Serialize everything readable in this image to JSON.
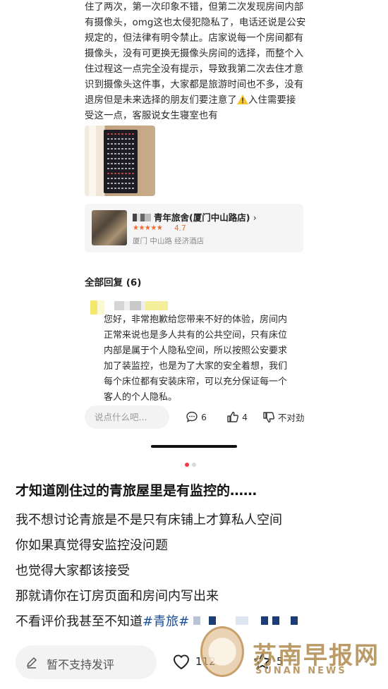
{
  "review": {
    "lines": [
      "住了两次，第一次印象不错，但第二次发现房间内部",
      "有摄像头，omg这也太侵犯隐私了，电话还说是公安",
      "规定的，但法律有明令禁止。店家说每一个房间都有",
      "摄像头，没有可更换无摄像头房间的选择，而整个入",
      "住过程这一点完全没有提示，导致我第二次去住才意",
      "识到摄像头这件事，大家都是旅游时间也不多，没有"
    ],
    "line7_before": "退房但是未来选择的朋友们要注意了",
    "line7_after": "入住需要接",
    "line8": "受这一点，客服说女生寝室也有",
    "warning_icon": "warning-icon"
  },
  "hotel_card": {
    "name": "青年旅舍(厦门中山路店)",
    "chevron": "›",
    "stars": "★★★★★",
    "score": "4.7",
    "tags": "厦门 中山路 经济酒店"
  },
  "replies": {
    "title": "全部回复 (6)",
    "merchant_reply_lines": [
      "您好，非常抱歉给您带来不好的体验，房间内",
      "正常来说也是多人共有的公共空间，只有床位",
      "内部是属于个人隐私空间，所以按照公安要求",
      "加了装监控，也是为了大家的安全着想，我们",
      "每个床位都有安装床帘，可以充分保证每一个",
      "客人的个人隐私。"
    ]
  },
  "comment_bar": {
    "placeholder": "说点什么吧...",
    "comments": "6",
    "likes": "4",
    "dislike_label": "不对劲"
  },
  "post": {
    "title": "才知道刚住过的青旅屋里是有监控的……",
    "lines": [
      "我不想讨论青旅是不是只有床铺上才算私人空间",
      "你如果真觉得安监控没问题",
      "也觉得大家都该接受",
      "那就请你在订房页面和房间内写出来"
    ],
    "last_line_prefix": "不看评价我甚至不知道",
    "tag": "#青旅#"
  },
  "bottom_bar": {
    "reply_placeholder": "暂不支持发评",
    "likes": "112",
    "stars": "5"
  },
  "watermark": {
    "cn": "苏南早报网",
    "en": "SUNAN NEWS"
  },
  "colors": {
    "accent": "#f23d4f",
    "rating": "#f06a2e",
    "tag": "#1b4f9b"
  }
}
